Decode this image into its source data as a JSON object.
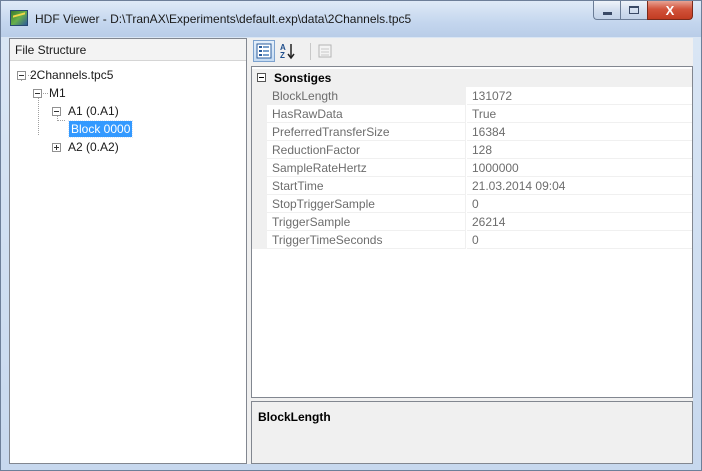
{
  "window": {
    "title": "HDF Viewer - D:\\TranAX\\Experiments\\default.exp\\data\\2Channels.tpc5",
    "controls": {
      "minimize_icon": "minimize-icon",
      "maximize_icon": "maximize-icon",
      "close_label": "X"
    }
  },
  "tree": {
    "header": "File Structure",
    "nodes": [
      {
        "label": "2Channels.tpc5",
        "state": "expanded"
      },
      {
        "label": "M1",
        "state": "expanded"
      },
      {
        "label": "A1 (0.A1)",
        "state": "expanded"
      },
      {
        "label": "Block 0000",
        "state": "selected"
      },
      {
        "label": "A2 (0.A2)",
        "state": "collapsed"
      }
    ]
  },
  "property_grid": {
    "toolbar": {
      "categorized_icon": "categorized-view-icon",
      "alphabetical_icon": "alphabetical-sort-icon",
      "property_pages_icon": "property-pages-icon"
    },
    "category": "Sonstiges",
    "properties": [
      {
        "name": "BlockLength",
        "value": "131072"
      },
      {
        "name": "HasRawData",
        "value": "True"
      },
      {
        "name": "PreferredTransferSize",
        "value": "16384"
      },
      {
        "name": "ReductionFactor",
        "value": "128"
      },
      {
        "name": "SampleRateHertz",
        "value": "1000000"
      },
      {
        "name": "StartTime",
        "value": "21.03.2014 09:04"
      },
      {
        "name": "StopTriggerSample",
        "value": "0"
      },
      {
        "name": "TriggerSample",
        "value": "26214"
      },
      {
        "name": "TriggerTimeSeconds",
        "value": "0"
      }
    ],
    "help_title": "BlockLength"
  },
  "colors": {
    "selection": "#3399ff",
    "close_button": "#c23c22",
    "frame": "#c7d8ee"
  }
}
